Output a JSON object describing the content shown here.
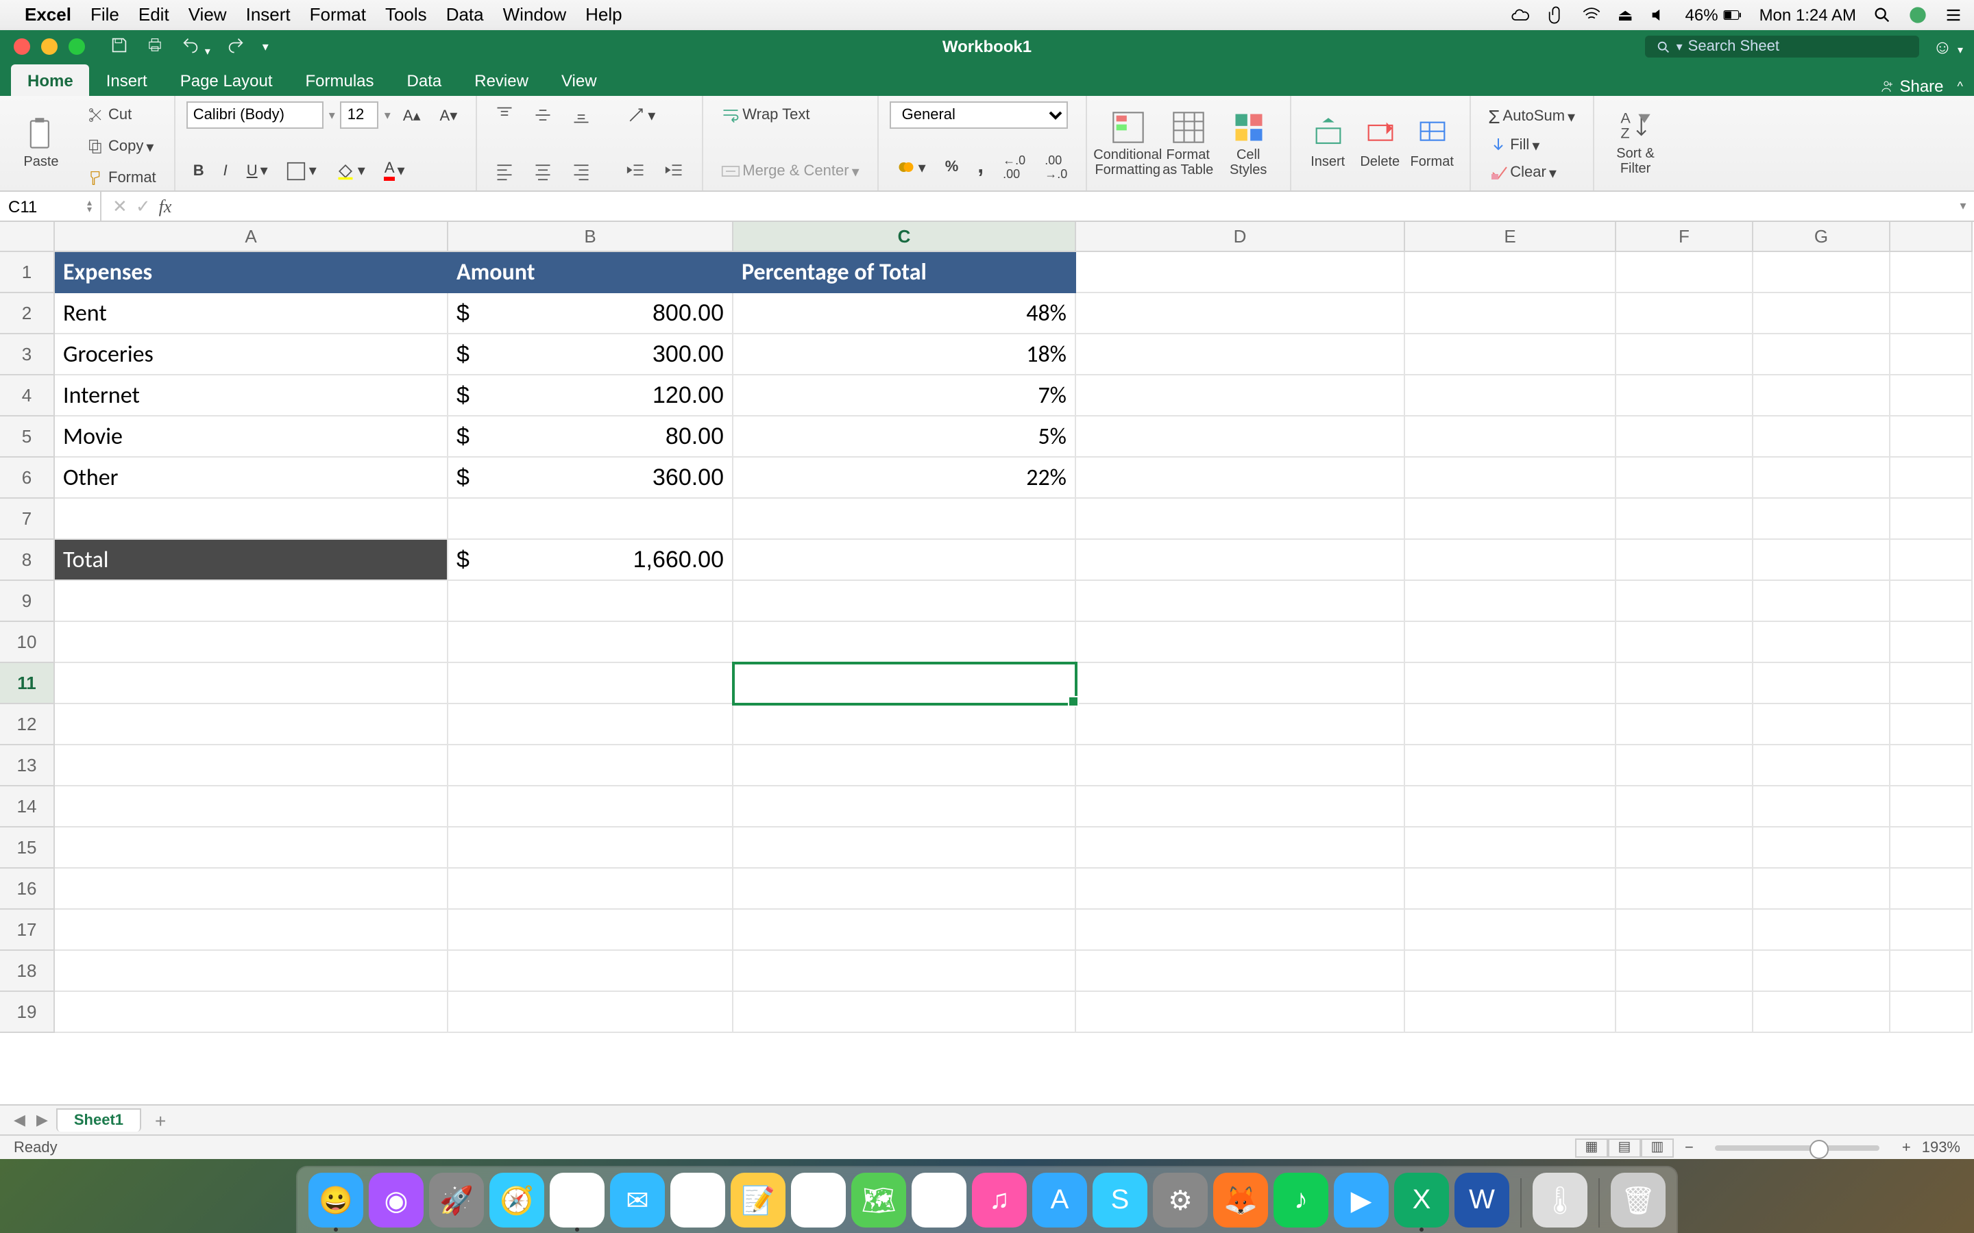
{
  "menubar": {
    "app": "Excel",
    "menus": [
      "File",
      "Edit",
      "View",
      "Insert",
      "Format",
      "Tools",
      "Data",
      "Window",
      "Help"
    ],
    "battery": "46%",
    "clock": "Mon 1:24 AM"
  },
  "titlebar": {
    "title": "Workbook1",
    "search_placeholder": "Search Sheet"
  },
  "ribbon_tabs": [
    "Home",
    "Insert",
    "Page Layout",
    "Formulas",
    "Data",
    "Review",
    "View"
  ],
  "share_label": "Share",
  "ribbon": {
    "paste": "Paste",
    "cut": "Cut",
    "copy": "Copy",
    "format_painter": "Format",
    "font_name": "Calibri (Body)",
    "font_size": "12",
    "wrap_text": "Wrap Text",
    "merge_center": "Merge & Center",
    "number_format": "General",
    "cond_fmt": "Conditional Formatting",
    "fmt_table": "Format as Table",
    "cell_styles": "Cell Styles",
    "insert": "Insert",
    "delete": "Delete",
    "format": "Format",
    "autosum": "AutoSum",
    "fill": "Fill",
    "clear": "Clear",
    "sort_filter": "Sort & Filter"
  },
  "formula_bar": {
    "cell_ref": "C11",
    "formula": ""
  },
  "columns": [
    "A",
    "B",
    "C",
    "D",
    "E",
    "F",
    "G"
  ],
  "row_count": 19,
  "active_cell": {
    "col": "C",
    "row": 11
  },
  "data": {
    "headers": {
      "A": "Expenses",
      "B": "Amount",
      "C": "Percentage of Total"
    },
    "rows": [
      {
        "A": "Rent",
        "B_currency": "$",
        "B_value": "800.00",
        "C": "48%"
      },
      {
        "A": "Groceries",
        "B_currency": "$",
        "B_value": "300.00",
        "C": "18%"
      },
      {
        "A": "Internet",
        "B_currency": "$",
        "B_value": "120.00",
        "C": "7%"
      },
      {
        "A": "Movie",
        "B_currency": "$",
        "B_value": "80.00",
        "C": "5%"
      },
      {
        "A": "Other",
        "B_currency": "$",
        "B_value": "360.00",
        "C": "22%"
      }
    ],
    "total": {
      "A": "Total",
      "B_currency": "$",
      "B_value": "1,660.00"
    }
  },
  "sheet_tabs": {
    "active": "Sheet1"
  },
  "statusbar": {
    "ready": "Ready",
    "zoom": "193%"
  },
  "dock": [
    "finder",
    "siri",
    "launchpad",
    "safari",
    "chrome",
    "mail",
    "calendar",
    "notes",
    "reminders",
    "maps",
    "photos",
    "itunes",
    "appstore",
    "skype",
    "settings",
    "firefox",
    "spotify",
    "zoom",
    "excel",
    "word",
    "thermometer",
    "trash"
  ]
}
